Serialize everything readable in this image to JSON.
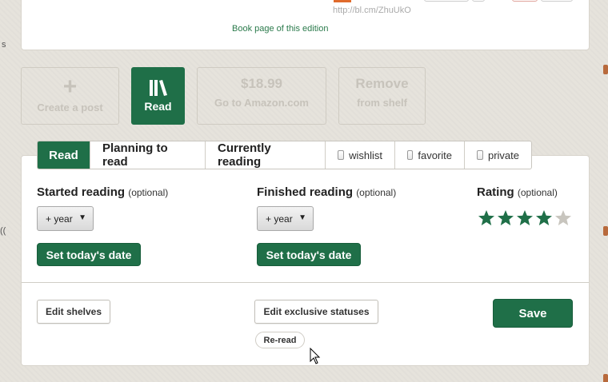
{
  "top": {
    "short_url": "http://bl.cm/ZhuUkO",
    "book_link": "Book page of this edition"
  },
  "actions": {
    "create_plus": "+",
    "create_label": "Create a post",
    "read_label": "Read",
    "amazon_price": "$18.99",
    "amazon_label": "Go to Amazon.com",
    "remove_line1": "Remove",
    "remove_line2": "from shelf"
  },
  "tabs": [
    {
      "label": "Read",
      "active": true
    },
    {
      "label": "Planning to read"
    },
    {
      "label": "Currently reading"
    },
    {
      "label": "wishlist",
      "checkbox": true
    },
    {
      "label": "favorite",
      "checkbox": true
    },
    {
      "label": "private",
      "checkbox": true
    }
  ],
  "started": {
    "title": "Started reading",
    "optional": "(optional)",
    "year_select": "+ year",
    "today_button": "Set today's date"
  },
  "finished": {
    "title": "Finished reading",
    "optional": "(optional)",
    "year_select": "+ year",
    "today_button": "Set today's date"
  },
  "rating": {
    "title": "Rating",
    "optional": "(optional)",
    "value": 4,
    "max": 5
  },
  "footer": {
    "edit_shelves": "Edit shelves",
    "edit_exclusive": "Edit exclusive statuses",
    "reread": "Re-read",
    "save": "Save"
  },
  "edge_left": [
    "s",
    "(("
  ],
  "colors": {
    "accent": "#1f6f48",
    "star_on": "#1f6f48",
    "star_off": "#c8c5be"
  }
}
